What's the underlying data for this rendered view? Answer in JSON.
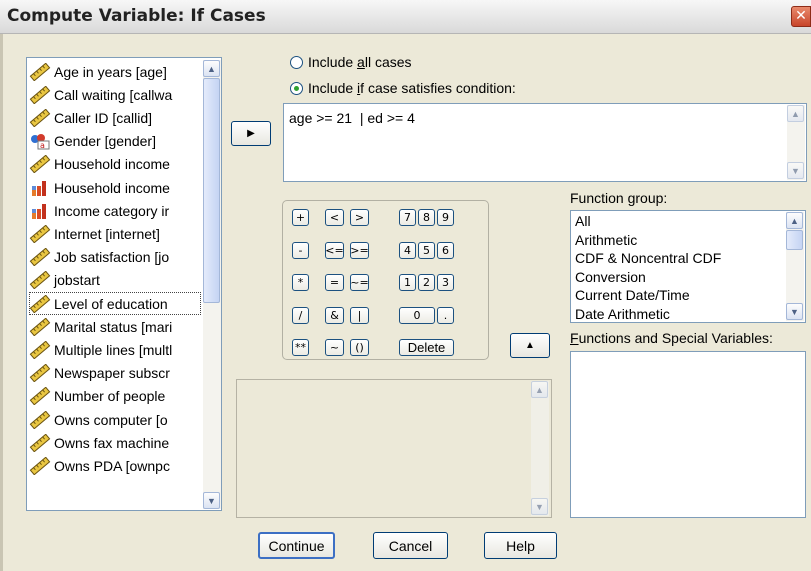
{
  "dialog": {
    "title": "Compute Variable: If Cases",
    "close_glyph": "✕"
  },
  "variables": [
    {
      "label": "Age in years [age]",
      "icon": "scale-ruler-icon"
    },
    {
      "label": "Call waiting [callwa",
      "icon": "scale-ruler-icon"
    },
    {
      "label": "Caller ID [callid]",
      "icon": "scale-ruler-icon"
    },
    {
      "label": "Gender [gender]",
      "icon": "nominal-string-icon"
    },
    {
      "label": "Household income",
      "icon": "scale-ruler-icon"
    },
    {
      "label": "Household income",
      "icon": "ordinal-bars-icon"
    },
    {
      "label": "Income category ir",
      "icon": "ordinal-bars-icon"
    },
    {
      "label": "Internet [internet]",
      "icon": "scale-ruler-icon"
    },
    {
      "label": "Job satisfaction [jo",
      "icon": "scale-ruler-icon"
    },
    {
      "label": "jobstart",
      "icon": "scale-ruler-icon"
    },
    {
      "label": "Level of education",
      "icon": "scale-ruler-icon",
      "selected": true
    },
    {
      "label": "Marital status [mari",
      "icon": "scale-ruler-icon"
    },
    {
      "label": "Multiple lines [multl",
      "icon": "scale-ruler-icon"
    },
    {
      "label": "Newspaper subscr",
      "icon": "scale-ruler-icon"
    },
    {
      "label": "Number of people",
      "icon": "scale-ruler-icon"
    },
    {
      "label": "Owns computer [o",
      "icon": "scale-ruler-icon"
    },
    {
      "label": "Owns fax machine",
      "icon": "scale-ruler-icon"
    },
    {
      "label": "Owns PDA [ownpc",
      "icon": "scale-ruler-icon"
    }
  ],
  "condition": {
    "include_all_label": "Include all cases",
    "include_all_access_key": "a",
    "include_if_label": "Include if case satisfies condition:",
    "include_if_access_key": "i",
    "selected": "include_if",
    "expression": "age >= 21  | ed >= 4"
  },
  "calculator": {
    "keys": [
      "+",
      "<",
      ">",
      "7",
      "8",
      "9",
      "-",
      "<=",
      ">=",
      "4",
      "5",
      "6",
      "*",
      "=",
      "~=",
      "1",
      "2",
      "3",
      "/",
      "&",
      "|",
      "0",
      ".",
      "**",
      "~",
      "()",
      "Delete"
    ]
  },
  "function_group": {
    "label": "Function group:",
    "access_key": "g",
    "items": [
      "All",
      "Arithmetic",
      "CDF & Noncentral CDF",
      "Conversion",
      "Current Date/Time",
      "Date Arithmetic"
    ]
  },
  "functions_label": "Functions and Special Variables:",
  "functions_access_key": "F",
  "buttons": {
    "continue": "Continue",
    "cancel": "Cancel",
    "help": "Help"
  }
}
